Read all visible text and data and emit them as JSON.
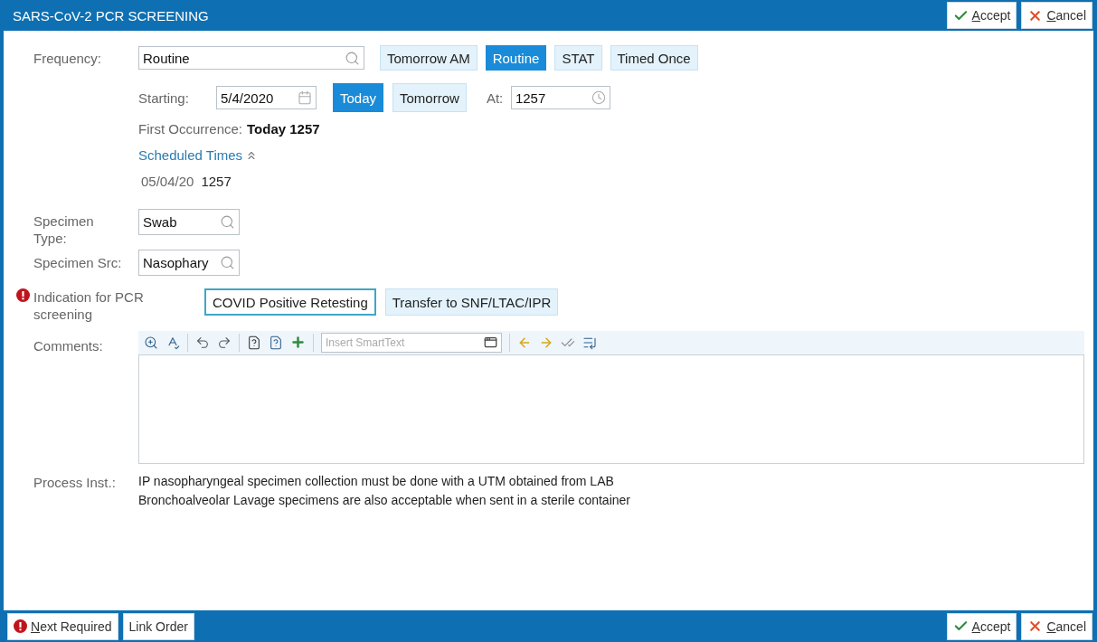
{
  "window": {
    "title": "SARS-CoV-2 PCR SCREENING"
  },
  "header_buttons": [
    {
      "kind": "accept",
      "label": "Accept"
    },
    {
      "kind": "cancel",
      "label": "Cancel"
    }
  ],
  "frequency": {
    "label": "Frequency:",
    "value": "Routine",
    "options": [
      {
        "label": "Tomorrow AM",
        "selected": false
      },
      {
        "label": "Routine",
        "selected": true
      },
      {
        "label": "STAT",
        "selected": false
      },
      {
        "label": "Timed Once",
        "selected": false
      }
    ]
  },
  "starting": {
    "label": "Starting:",
    "date": "5/4/2020",
    "options": [
      {
        "label": "Today",
        "selected": true
      },
      {
        "label": "Tomorrow",
        "selected": false
      }
    ],
    "at_label": "At:",
    "time": "1257"
  },
  "first_occurrence": {
    "label": "First Occurrence:",
    "value": "Today 1257"
  },
  "scheduled_times": {
    "label": "Scheduled Times",
    "expanded": true,
    "entries": [
      {
        "date": "05/04/20",
        "time": "1257"
      }
    ]
  },
  "specimen_type": {
    "label": "Specimen Type:",
    "value": "Swab"
  },
  "specimen_src": {
    "label": "Specimen Src:",
    "value": "Nasophary"
  },
  "indication": {
    "required": true,
    "label": "Indication for PCR screening",
    "options": [
      {
        "label": "COVID Positive Retesting",
        "focused": true
      },
      {
        "label": "Transfer to SNF/LTAC/IPR",
        "focused": false
      }
    ]
  },
  "comments": {
    "label": "Comments:",
    "smarttext_placeholder": "Insert SmartText"
  },
  "process_inst": {
    "label": "Process Inst.:",
    "lines": [
      "IP nasopharyngeal specimen collection must be done with a UTM obtained from LAB",
      "Bronchoalveolar Lavage specimens are also acceptable when sent in a sterile container"
    ]
  },
  "footer": {
    "left_buttons": [
      {
        "kind": "next_required",
        "label": "Next Required"
      },
      {
        "kind": "link",
        "label": "Link Order"
      }
    ],
    "right_buttons": [
      {
        "kind": "accept",
        "label": "Accept"
      },
      {
        "kind": "cancel",
        "label": "Cancel"
      }
    ]
  }
}
